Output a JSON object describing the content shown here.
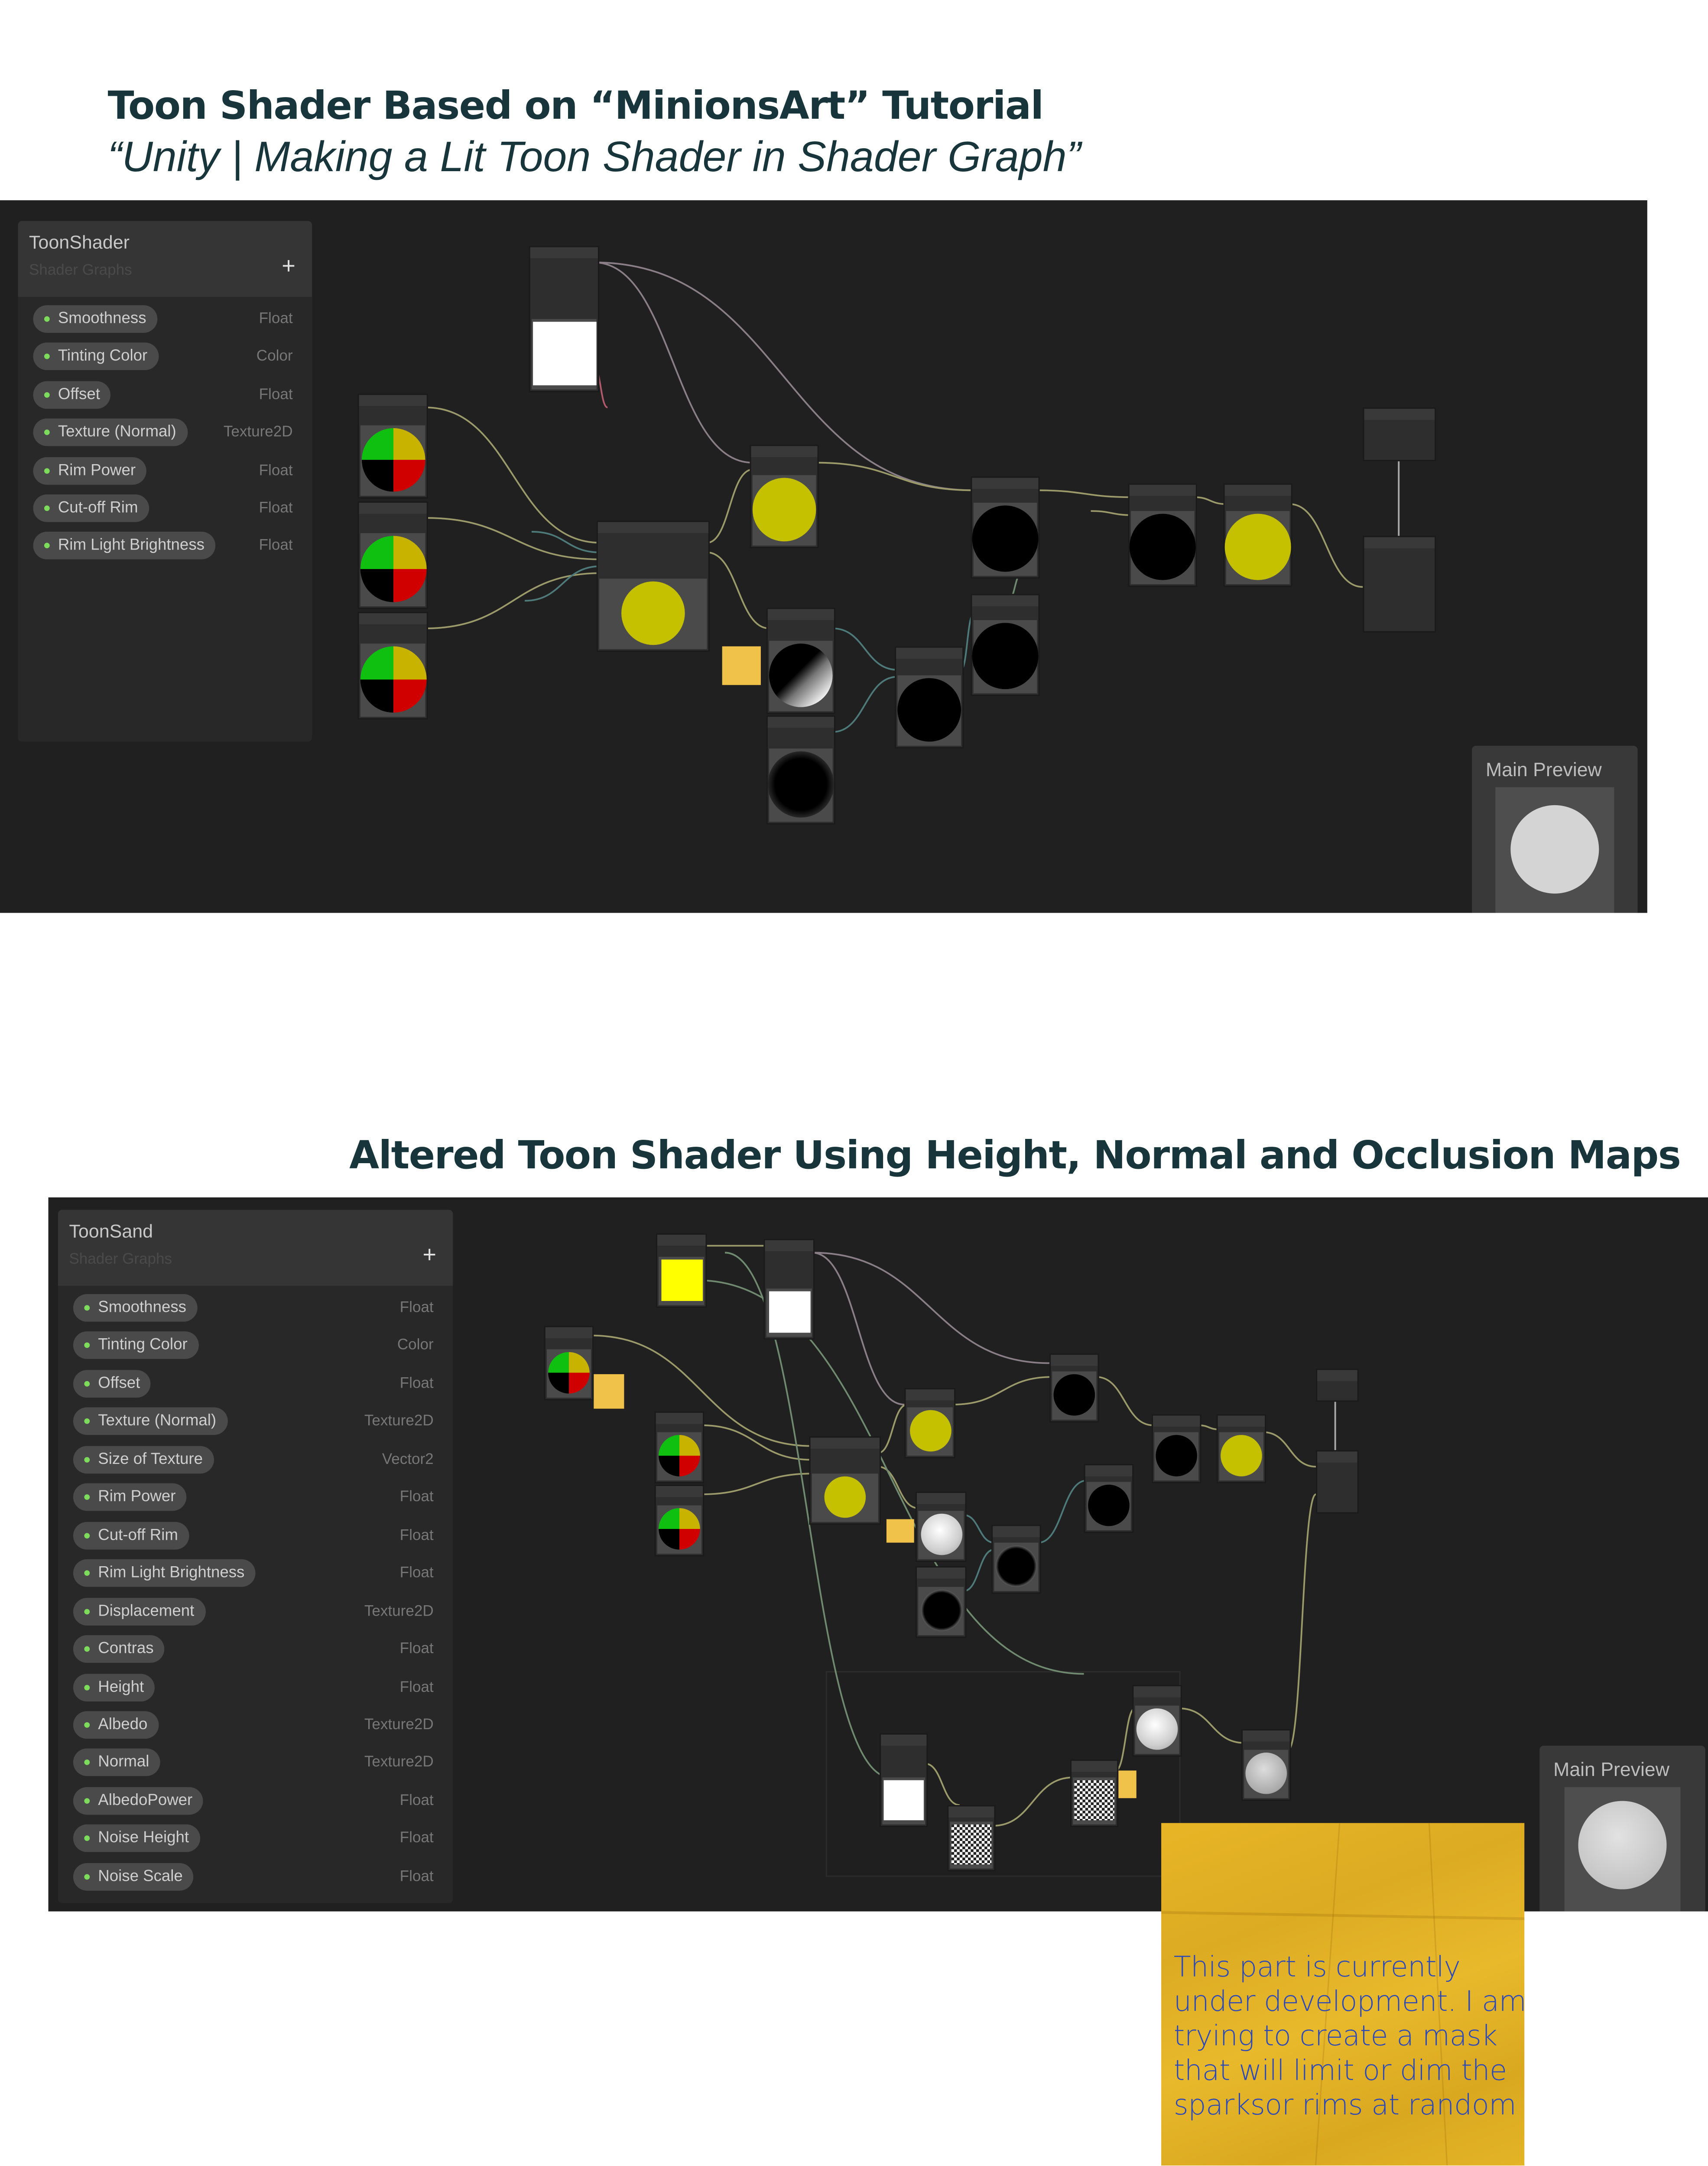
{
  "section1": {
    "title": "Toon Shader Based on “MinionsArt” Tutorial",
    "subtitle": "“Unity | Making a Lit Toon Shader in Shader Graph”",
    "blackboard": {
      "name": "ToonShader",
      "subtitle": "Shader Graphs",
      "add_icon": "plus-icon",
      "properties": [
        {
          "name": "Smoothness",
          "type": "Float"
        },
        {
          "name": "Tinting Color",
          "type": "Color"
        },
        {
          "name": "Offset",
          "type": "Float"
        },
        {
          "name": "Texture (Normal)",
          "type": "Texture2D"
        },
        {
          "name": "Rim Power",
          "type": "Float"
        },
        {
          "name": "Cut-off Rim",
          "type": "Float"
        },
        {
          "name": "Rim Light Brightness",
          "type": "Float"
        }
      ]
    },
    "main_preview": "Main Preview"
  },
  "section2": {
    "title": "Altered Toon Shader Using Height, Normal and Occlusion Maps",
    "blackboard": {
      "name": "ToonSand",
      "subtitle": "Shader Graphs",
      "add_icon": "plus-icon",
      "properties": [
        {
          "name": "Smoothness",
          "type": "Float"
        },
        {
          "name": "Tinting Color",
          "type": "Color"
        },
        {
          "name": "Offset",
          "type": "Float"
        },
        {
          "name": "Texture (Normal)",
          "type": "Texture2D"
        },
        {
          "name": "Size of Texture",
          "type": "Vector2"
        },
        {
          "name": "Rim Power",
          "type": "Float"
        },
        {
          "name": "Cut-off Rim",
          "type": "Float"
        },
        {
          "name": "Rim Light Brightness",
          "type": "Float"
        },
        {
          "name": "Displacement",
          "type": "Texture2D"
        },
        {
          "name": "Contras",
          "type": "Float"
        },
        {
          "name": "Height",
          "type": "Float"
        },
        {
          "name": "Albedo",
          "type": "Texture2D"
        },
        {
          "name": "Normal",
          "type": "Texture2D"
        },
        {
          "name": "AlbedoPower",
          "type": "Float"
        },
        {
          "name": "Noise Height",
          "type": "Float"
        },
        {
          "name": "Noise Scale",
          "type": "Float"
        }
      ]
    },
    "main_preview": "Main Preview"
  },
  "sticky_note": {
    "lines": [
      "This part is currently",
      "under development. I am",
      "trying to create a mask",
      "that will limit or dim the",
      "sparksor rims at random"
    ]
  },
  "colors": {
    "title": "#17353a",
    "canvas": "#202020",
    "preview_yellow": "#c5c000",
    "property_dot": "#7edc5c",
    "note_text": "#2a48b8",
    "note_paper": "#e4b427"
  }
}
